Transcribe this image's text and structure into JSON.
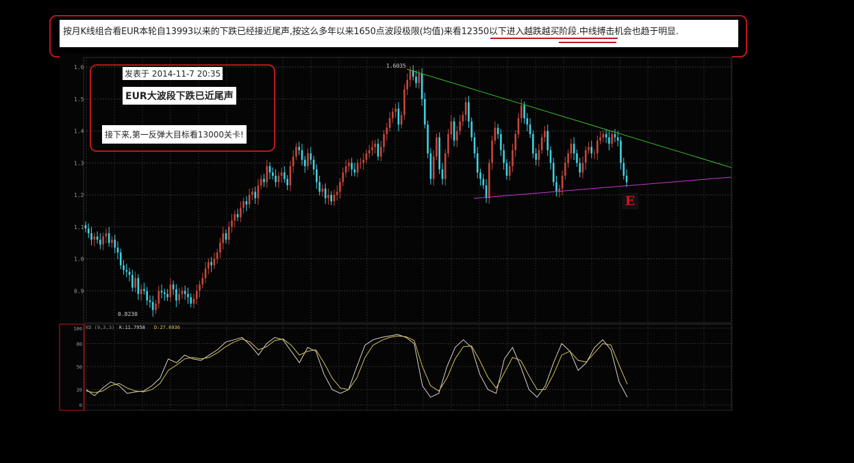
{
  "note": {
    "text_a": "按月K线组合看EUR本轮自13993以来的下跌已经接近尾声,按这么多年以来1650点波段极限(均值)来看",
    "text_b": "12350以下进入",
    "text_c": "越跌越买",
    "text_d": "阶段",
    "text_e": ".中线搏击机会也趋于明显."
  },
  "annotation": {
    "date": "发表于 2014-11-7 20:35",
    "title": "EUR大波段下跌已近尾声",
    "target": "接下来,第一反弹大目标看13000关卡!",
    "marker": "E"
  },
  "colors": {
    "up": "#c7483c",
    "down": "#3fd3e3",
    "upper_trendline": "#38c02c",
    "lower_trendline": "#cb35d8",
    "k_line": "#ddd6c9",
    "d_line": "#d8c25a",
    "frame_red": "#c0151b"
  },
  "chart_data": [
    {
      "type": "candlestick",
      "instrument": "EUR",
      "ylim": [
        0.8,
        1.65
      ],
      "yticks": [
        "1.6",
        "1.5",
        "1.4",
        "1.3",
        "1.2",
        "1.1",
        "1.0",
        "0.9"
      ],
      "annotations": {
        "high": "1.6035",
        "low": "0.8230"
      },
      "close": [
        1.095,
        1.08,
        1.06,
        1.07,
        1.06,
        1.045,
        1.07,
        1.08,
        1.05,
        1.06,
        1.035,
        1.02,
        0.98,
        0.965,
        0.96,
        0.95,
        0.91,
        0.94,
        0.89,
        0.905,
        0.9,
        0.87,
        0.865,
        0.84,
        0.86,
        0.9,
        0.895,
        0.89,
        0.88,
        0.92,
        0.905,
        0.87,
        0.89,
        0.9,
        0.89,
        0.88,
        0.86,
        0.875,
        0.9,
        0.92,
        0.94,
        0.97,
        0.99,
        0.98,
        1.0,
        1.02,
        1.05,
        1.08,
        1.06,
        1.1,
        1.12,
        1.14,
        1.13,
        1.16,
        1.18,
        1.17,
        1.2,
        1.21,
        1.19,
        1.23,
        1.25,
        1.24,
        1.29,
        1.27,
        1.26,
        1.24,
        1.26,
        1.27,
        1.25,
        1.23,
        1.29,
        1.32,
        1.35,
        1.34,
        1.31,
        1.29,
        1.33,
        1.31,
        1.28,
        1.24,
        1.21,
        1.22,
        1.19,
        1.2,
        1.18,
        1.2,
        1.21,
        1.24,
        1.27,
        1.29,
        1.3,
        1.28,
        1.27,
        1.3,
        1.3,
        1.31,
        1.33,
        1.34,
        1.35,
        1.36,
        1.32,
        1.35,
        1.39,
        1.41,
        1.44,
        1.46,
        1.47,
        1.42,
        1.45,
        1.53,
        1.56,
        1.59,
        1.57,
        1.55,
        1.58,
        1.5,
        1.42,
        1.33,
        1.25,
        1.32,
        1.38,
        1.28,
        1.25,
        1.33,
        1.39,
        1.43,
        1.37,
        1.4,
        1.43,
        1.45,
        1.49,
        1.43,
        1.38,
        1.33,
        1.27,
        1.25,
        1.23,
        1.19,
        1.3,
        1.37,
        1.41,
        1.39,
        1.34,
        1.3,
        1.26,
        1.29,
        1.34,
        1.39,
        1.44,
        1.48,
        1.44,
        1.42,
        1.39,
        1.33,
        1.31,
        1.34,
        1.38,
        1.4,
        1.34,
        1.3,
        1.24,
        1.21,
        1.22,
        1.26,
        1.3,
        1.33,
        1.36,
        1.33,
        1.3,
        1.27,
        1.3,
        1.34,
        1.35,
        1.33,
        1.33,
        1.37,
        1.38,
        1.39,
        1.38,
        1.36,
        1.39,
        1.38,
        1.37,
        1.3,
        1.26,
        1.24
      ]
    },
    {
      "type": "line",
      "indicator": "KD (9,3,3)",
      "legend": [
        {
          "name": "K",
          "value": "11.7958"
        },
        {
          "name": "D",
          "value": "27.6936"
        }
      ],
      "ylim": [
        0,
        100
      ],
      "yticks": [
        "100",
        "80",
        "50",
        "20",
        "0"
      ],
      "series": [
        {
          "name": "K",
          "values": [
            20,
            12,
            22,
            30,
            25,
            15,
            17,
            18,
            25,
            35,
            60,
            55,
            65,
            60,
            58,
            65,
            72,
            82,
            85,
            88,
            78,
            65,
            80,
            88,
            85,
            70,
            55,
            75,
            70,
            40,
            20,
            15,
            20,
            50,
            78,
            85,
            88,
            90,
            92,
            88,
            80,
            25,
            10,
            15,
            50,
            75,
            85,
            75,
            40,
            20,
            15,
            60,
            75,
            50,
            20,
            10,
            25,
            55,
            80,
            70,
            45,
            55,
            75,
            85,
            72,
            30,
            10
          ]
        },
        {
          "name": "D",
          "values": [
            18,
            16,
            18,
            25,
            28,
            22,
            18,
            17,
            20,
            28,
            45,
            52,
            60,
            62,
            60,
            62,
            68,
            76,
            82,
            86,
            82,
            72,
            76,
            84,
            86,
            78,
            65,
            70,
            72,
            55,
            35,
            22,
            20,
            35,
            62,
            78,
            84,
            88,
            90,
            89,
            84,
            50,
            25,
            18,
            35,
            60,
            76,
            77,
            58,
            36,
            22,
            42,
            62,
            58,
            38,
            20,
            20,
            40,
            65,
            70,
            58,
            56,
            68,
            80,
            78,
            52,
            27
          ]
        }
      ]
    }
  ]
}
